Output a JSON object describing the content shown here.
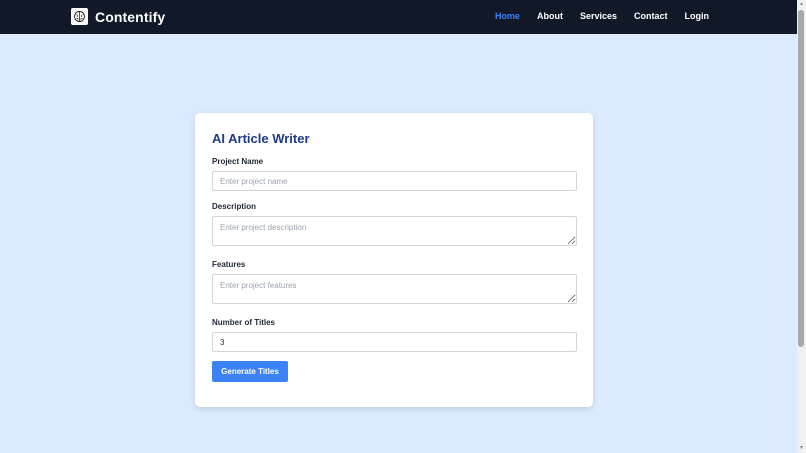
{
  "app": {
    "brand_name": "Contentify",
    "logo_icon": "brain-icon"
  },
  "nav": {
    "items": [
      {
        "label": "Home",
        "active": true
      },
      {
        "label": "About",
        "active": false
      },
      {
        "label": "Services",
        "active": false
      },
      {
        "label": "Contact",
        "active": false
      },
      {
        "label": "Login",
        "active": false
      }
    ]
  },
  "form": {
    "title": "AI Article Writer",
    "project_name": {
      "label": "Project Name",
      "placeholder": "Enter project name",
      "value": ""
    },
    "description": {
      "label": "Description",
      "placeholder": "Enter project description",
      "value": ""
    },
    "features": {
      "label": "Features",
      "placeholder": "Enter project features",
      "value": ""
    },
    "num_titles": {
      "label": "Number of Titles",
      "value": "3"
    },
    "submit_label": "Generate Titles"
  },
  "colors": {
    "navbar_bg": "#111827",
    "page_bg": "#dbeafe",
    "accent": "#3b82f6",
    "title": "#1e3a8a"
  }
}
